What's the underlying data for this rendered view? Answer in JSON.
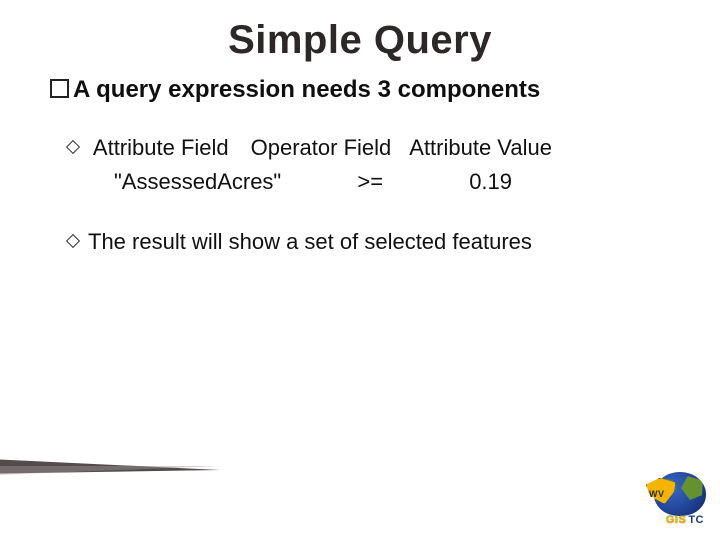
{
  "title": "Simple Query",
  "lead": {
    "prefix": "A",
    "text": "query expression needs 3 components"
  },
  "components": {
    "labels": {
      "attr_field": "Attribute Field",
      "op_field": "Operator Field",
      "attr_value": "Attribute Value"
    },
    "example": {
      "attr_field": "\"AssessedAcres\"",
      "op_field": ">=",
      "attr_value": "0.19"
    }
  },
  "result_line": "The result will show a set of selected features",
  "logo": {
    "state_abbrev": "WV",
    "org_part1": "GIS",
    "org_part2": "TC"
  }
}
